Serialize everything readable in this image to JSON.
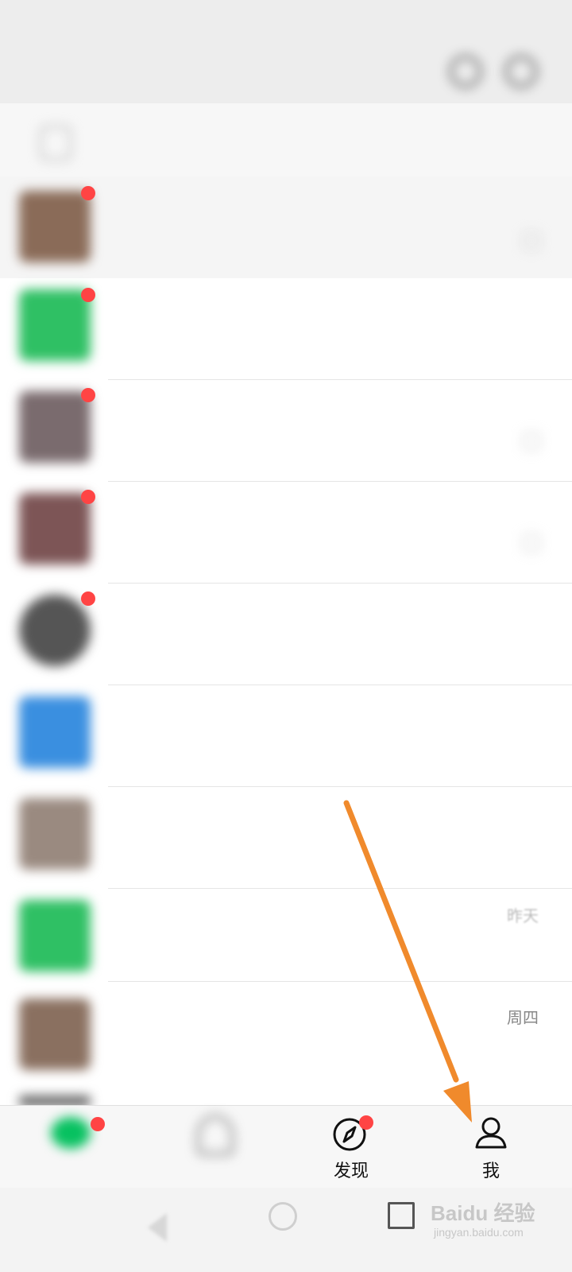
{
  "status_bar": {
    "left": "",
    "right": ""
  },
  "header": {
    "title": "",
    "search_icon": "search-icon",
    "add_icon": "plus-circle-icon"
  },
  "search": {
    "placeholder": ""
  },
  "chats": [
    {
      "name": "",
      "message": "",
      "time": "",
      "pinned": true
    },
    {
      "name": "",
      "message": "",
      "time": ""
    },
    {
      "name": "",
      "message": "",
      "time": ""
    },
    {
      "name": "",
      "message": "",
      "time": ""
    },
    {
      "name": "",
      "message": "",
      "time": ""
    },
    {
      "name": "",
      "message": "",
      "time": ""
    },
    {
      "name": "",
      "message": "",
      "time": ""
    },
    {
      "name": "",
      "message": "",
      "time": "昨天"
    },
    {
      "name": "",
      "message": "",
      "time": "周四"
    }
  ],
  "tabbar": {
    "tabs": [
      {
        "label": "",
        "icon": "chat-icon"
      },
      {
        "label": "",
        "icon": "contacts-icon"
      },
      {
        "label": "发现",
        "icon": "compass-icon"
      },
      {
        "label": "我",
        "icon": "person-icon"
      }
    ]
  },
  "watermark": {
    "main": "Baidu 经验",
    "sub": "jingyan.baidu.com"
  },
  "colors": {
    "wechat_green": "#07c160",
    "badge_red": "#f44444",
    "annotation_arrow": "#f08a2c"
  }
}
